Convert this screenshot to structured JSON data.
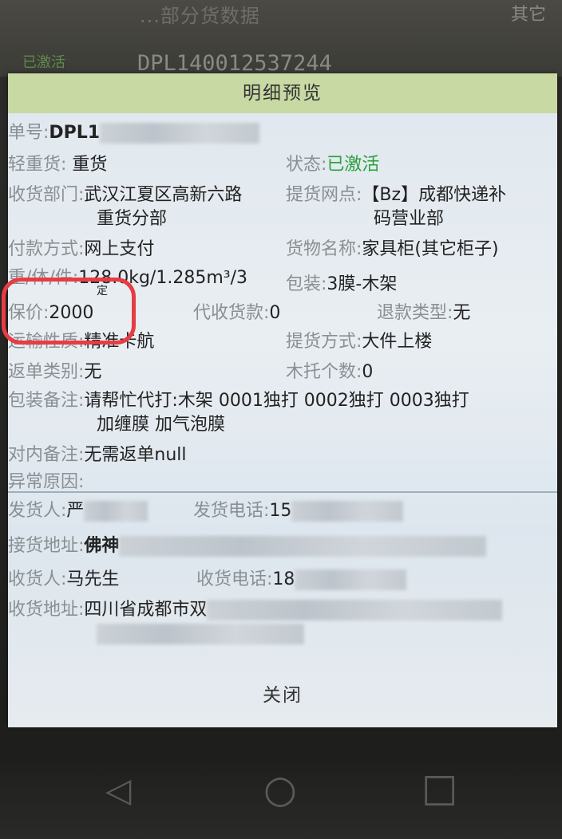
{
  "background": {
    "top_text_1": "...部分货数据",
    "top_text_2": "DPL140012537244",
    "top_text_3": "已激活",
    "top_text_4": "其它"
  },
  "dialog": {
    "title": "明细预览",
    "order_no_label": "单号:",
    "order_no_value": "DPL1",
    "weight_type_label": "轻重货:",
    "weight_type_value": "重货",
    "status_label": "状态:",
    "status_value": "已激活",
    "receiving_dept_label": "收货部门:",
    "receiving_dept_value_1": "武汉江夏区高新六路",
    "receiving_dept_value_2": "重货分部",
    "pickup_point_label": "提货网点:",
    "pickup_point_value_1": "【Bz】成都快递补",
    "pickup_point_value_2": "码营业部",
    "payment_label": "付款方式:",
    "payment_value": "网上支付",
    "goods_name_label": "货物名称:",
    "goods_name_value": "家具柜(其它柜子)",
    "weight_label": "重/体/件:",
    "weight_value": "128.0kg/1.285m³/3",
    "weight_extra": "定",
    "packing_label": "包装:",
    "packing_value": "3膜-木架",
    "insured_label": "保价:",
    "insured_value": "2000",
    "cod_label": "代收货款:",
    "cod_value": "0",
    "refund_type_label": "退款类型:",
    "refund_type_value": "无",
    "transport_label": "运输性质:",
    "transport_value": "精准卡航",
    "pickup_method_label": "提货方式:",
    "pickup_method_value": "大件上楼",
    "return_type_label": "返单类别:",
    "return_type_value": "无",
    "pallet_label": "木托个数:",
    "pallet_value": "0",
    "packing_note_label": "包装备注:",
    "packing_note_value_1": "请帮忙代打:木架 0001独打 0002独打 0003独打",
    "packing_note_value_2": "加缠膜 加气泡膜",
    "internal_note_label": "对内备注:",
    "internal_note_value": "无需返单null",
    "exception_label": "异常原因:",
    "shipper_label": "发货人:",
    "shipper_value": "严",
    "shipper_phone_label": "发货电话:",
    "shipper_phone_value": "15",
    "pickup_addr_label": "接货地址:",
    "pickup_addr_value": "佛神",
    "consignee_label": "收货人:",
    "consignee_value": "马先生",
    "consignee_phone_label": "收货电话:",
    "consignee_phone_value": "18",
    "consignee_addr_label": "收货地址:",
    "consignee_addr_value": "四川省成都市双",
    "close_label": "关闭"
  },
  "nav": {
    "back_icon": "◁",
    "home_icon": "○",
    "recents_icon": "□"
  },
  "colors": {
    "title_bar": "#c9d9a3",
    "status_green": "#2aa03a",
    "highlight_red": "#e63d45"
  }
}
